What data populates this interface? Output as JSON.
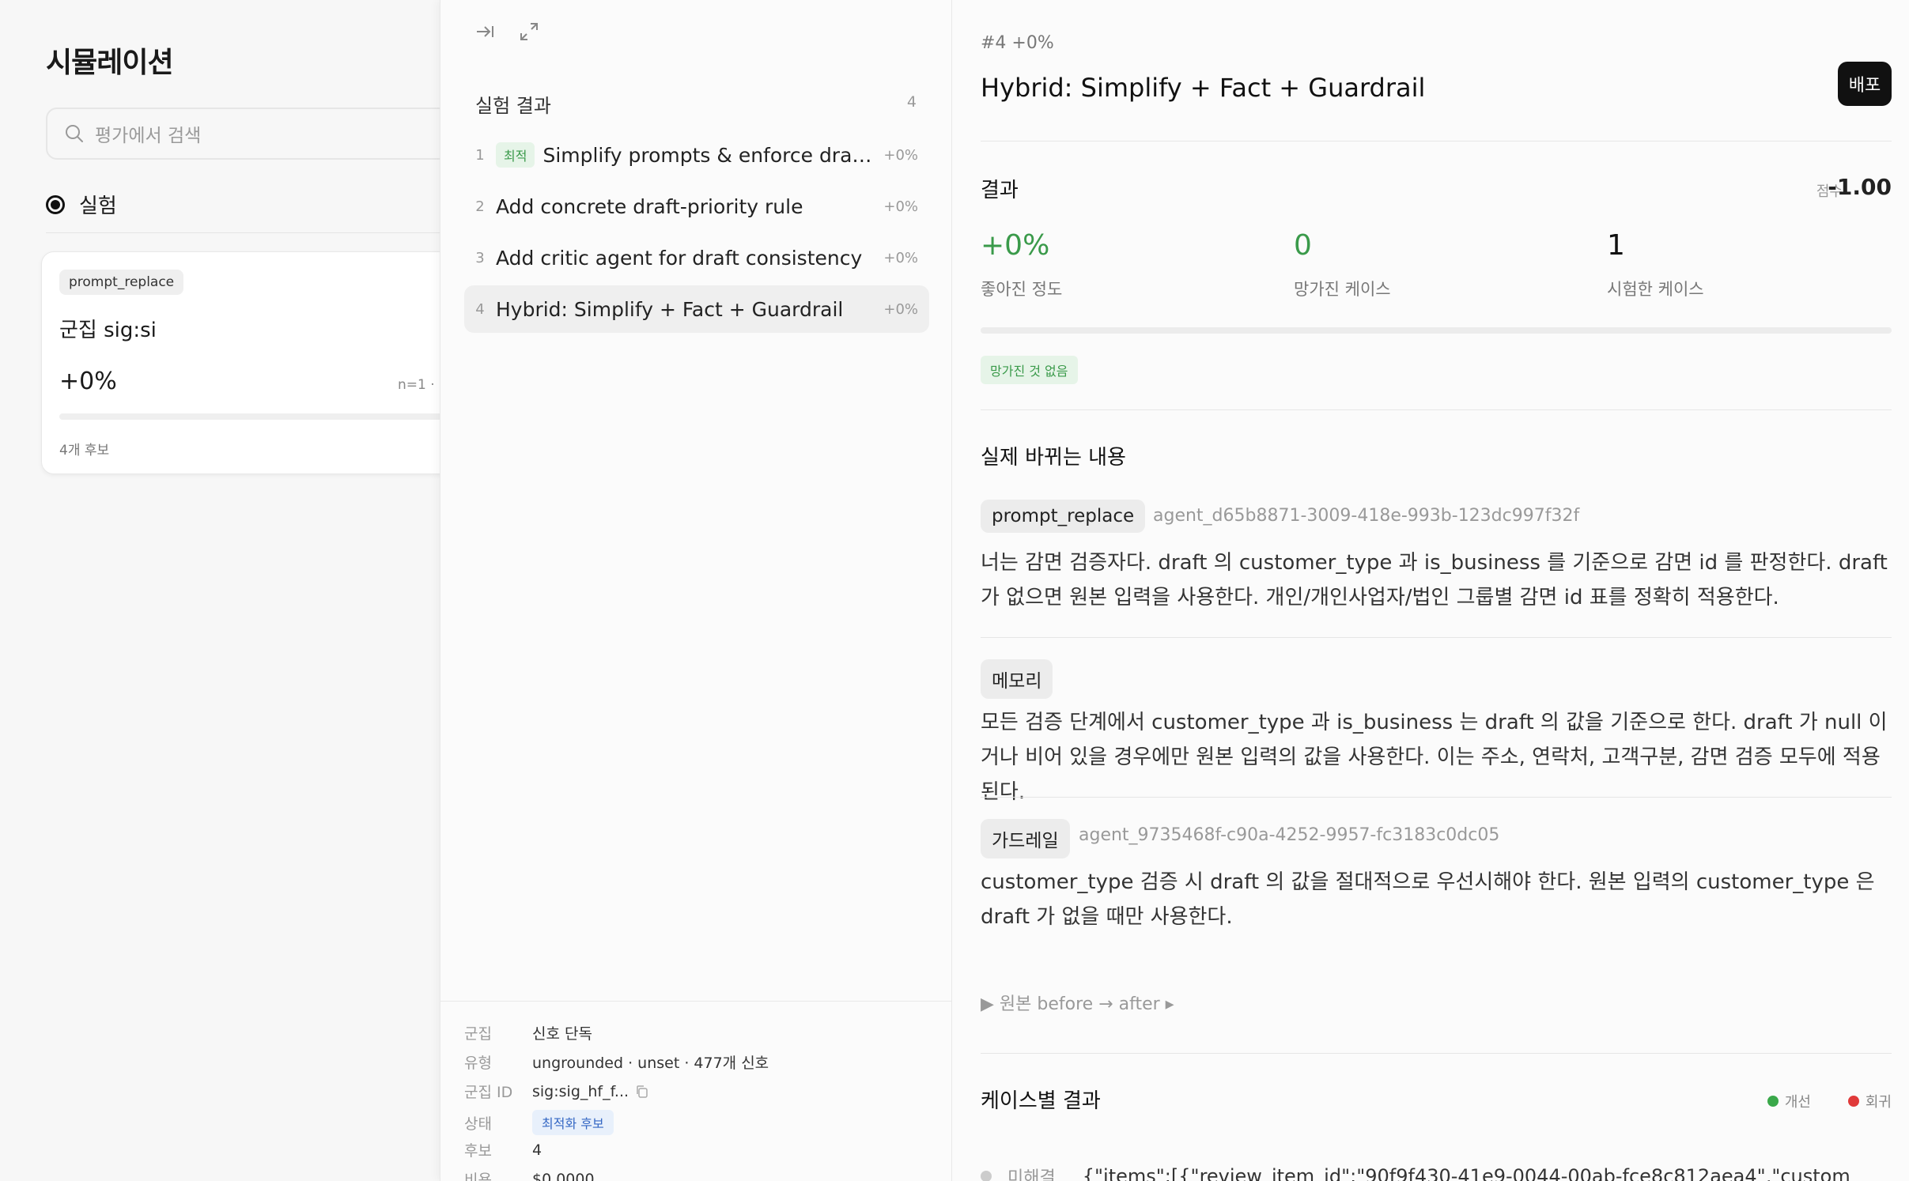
{
  "left": {
    "title": "시뮬레이션",
    "search_placeholder": "평가에서 검색",
    "mode_label": "실험",
    "card": {
      "tag": "prompt_replace",
      "title": "군집 sig:si",
      "value": "+0%",
      "meta": "n=1 · ",
      "footer": "4개 후보"
    }
  },
  "middle": {
    "header": "실험 결과",
    "count": "4",
    "experiments": [
      {
        "index": "1",
        "badge": "최적",
        "name": "Simplify prompts & enforce draft prio...",
        "delta": "+0%"
      },
      {
        "index": "2",
        "badge": "",
        "name": "Add concrete draft-priority rule",
        "delta": "+0%"
      },
      {
        "index": "3",
        "badge": "",
        "name": "Add critic agent for draft consistency",
        "delta": "+0%"
      },
      {
        "index": "4",
        "badge": "",
        "name": "Hybrid: Simplify + Fact + Guardrail",
        "delta": "+0%"
      }
    ],
    "meta": [
      {
        "key": "군집",
        "value": "신호 단독"
      },
      {
        "key": "유형",
        "value": "ungrounded · unset · 477개 신호"
      },
      {
        "key": "군집 ID",
        "value": "sig:sig_hf_f..."
      },
      {
        "key": "상태",
        "value": "최적화 후보"
      },
      {
        "key": "후보",
        "value": "4"
      },
      {
        "key": "비용",
        "value": "$0.0000"
      }
    ]
  },
  "right": {
    "id_line": "#4   +0%",
    "title": "Hybrid: Simplify + Fact + Guardrail",
    "deploy_label": "배포",
    "results_title": "결과",
    "score_label": "점수",
    "score_value": "-1.00",
    "stats": [
      {
        "value": "+0%",
        "label": "좋아진 정도",
        "color": "#3a9a4a"
      },
      {
        "value": "0",
        "label": "망가진 케이스",
        "color": "#3a9a4a"
      },
      {
        "value": "1",
        "label": "시험한 케이스",
        "color": "#111111"
      }
    ],
    "none_broken": "망가진 것 없음",
    "changes_title": "실제 바뀌는 내용",
    "changes": [
      {
        "chip": "prompt_replace",
        "agent": "agent_d65b8871-3009-418e-993b-123dc997f32f",
        "text": "너는 감면 검증자다. draft 의 customer_type 과 is_business 를 기준으로 감면 id 를 판정한다. draft 가 없으면 원본 입력을 사용한다. 개인/개인사업자/법인 그룹별 감면 id 표를 정확히 적용한다."
      },
      {
        "chip": "메모리",
        "agent": "",
        "text": "모든 검증 단계에서 customer_type 과 is_business 는 draft 의 값을 기준으로 한다. draft 가 null 이거나 비어 있을 경우에만 원본 입력의 값을 사용한다. 이는 주소, 연락처, 고객구분, 감면 검증 모두에 적용된다."
      },
      {
        "chip": "가드레일",
        "agent": "agent_9735468f-c90a-4252-9957-fc3183c0dc05",
        "text": "customer_type 검증 시 draft 의 값을 절대적으로 우선시해야 한다. 원본 입력의 customer_type 은 draft 가 없을 때만 사용한다."
      }
    ],
    "toggle_label": "▶ 원본 before → after ▸",
    "cases_title": "케이스별 결과",
    "legend_improve": "개선",
    "legend_regress": "회귀",
    "colors": {
      "improve": "#3aa84a",
      "regress": "#e03a3a"
    },
    "case_row": {
      "status": "미해결",
      "json": "{\"items\":[{\"review_item_id\":\"90f9f430-41e9-0044-00ab-fce8c812aea4\",\"custom"
    }
  }
}
